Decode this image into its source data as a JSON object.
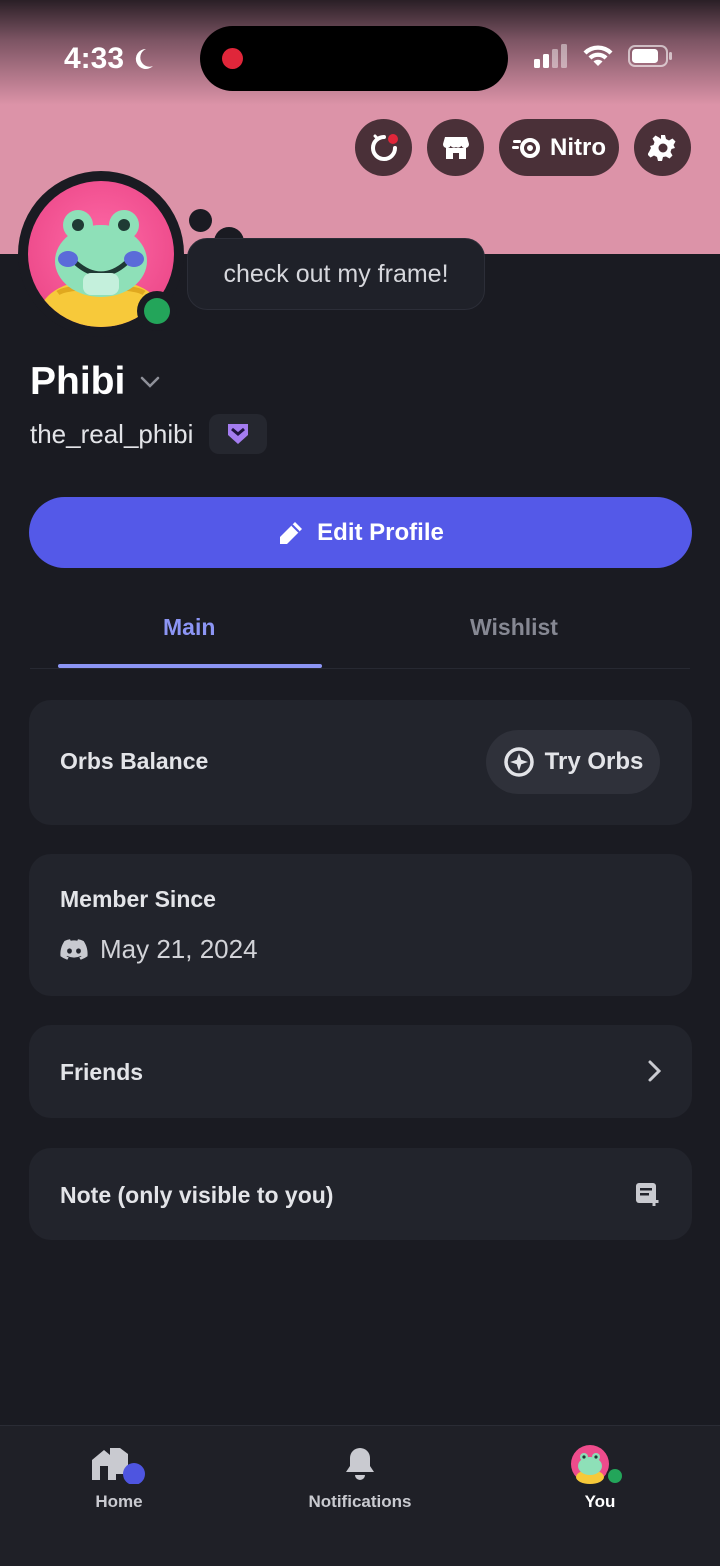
{
  "status_bar": {
    "time": "4:33"
  },
  "header": {
    "nitro_label": "Nitro"
  },
  "profile": {
    "status_message": "check out my frame!",
    "display_name": "Phibi",
    "username": "the_real_phibi",
    "edit_label": "Edit Profile"
  },
  "tabs": [
    {
      "label": "Main",
      "active": true
    },
    {
      "label": "Wishlist",
      "active": false
    }
  ],
  "cards": {
    "orbs": {
      "title": "Orbs Balance",
      "button": "Try Orbs"
    },
    "member": {
      "title": "Member Since",
      "date": "May 21, 2024"
    },
    "friends": {
      "title": "Friends"
    },
    "note": {
      "title": "Note (only visible to you)"
    }
  },
  "bottom_nav": [
    {
      "label": "Home",
      "icon": "home-icon"
    },
    {
      "label": "Notifications",
      "icon": "bell-icon"
    },
    {
      "label": "You",
      "icon": "avatar-icon"
    }
  ],
  "colors": {
    "banner": "#dc93a8",
    "accent": "#5459e8",
    "tab_active": "#8c95f4",
    "online": "#23a55a"
  }
}
